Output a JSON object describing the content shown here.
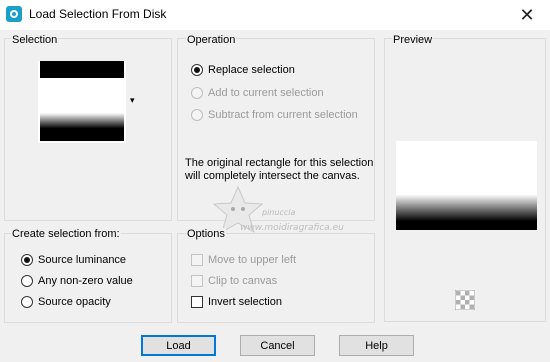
{
  "window": {
    "title": "Load Selection From Disk",
    "close_glyph": "✕",
    "app_icon": "paint-shop-pro-icon"
  },
  "selection": {
    "label": "Selection",
    "dropdown_glyph": "▾"
  },
  "operation": {
    "label": "Operation",
    "options": [
      {
        "label": "Replace selection",
        "checked": true,
        "enabled": true
      },
      {
        "label": "Add to current selection",
        "checked": false,
        "enabled": false
      },
      {
        "label": "Subtract from current selection",
        "checked": false,
        "enabled": false
      }
    ],
    "note": "The original rectangle for this selection will completely intersect the canvas."
  },
  "preview": {
    "label": "Preview",
    "checker_icon": "transparency-checker-icon"
  },
  "create_from": {
    "label": "Create selection from:",
    "options": [
      {
        "label": "Source luminance",
        "checked": true
      },
      {
        "label": "Any non-zero value",
        "checked": false
      },
      {
        "label": "Source opacity",
        "checked": false
      }
    ]
  },
  "options": {
    "label": "Options",
    "items": [
      {
        "label": "Move to upper left",
        "checked": false,
        "enabled": false
      },
      {
        "label": "Clip to canvas",
        "checked": false,
        "enabled": false
      },
      {
        "label": "Invert selection",
        "checked": false,
        "enabled": true
      }
    ]
  },
  "buttons": {
    "load": "Load",
    "cancel": "Cancel",
    "help": "Help"
  },
  "watermark": {
    "line1": "pinuccia",
    "line2": "www.moidiragrafica.eu"
  },
  "colors": {
    "accent": "#0078d7",
    "panel_border": "#dcdcdc",
    "disabled_text": "#9a9a9a"
  }
}
